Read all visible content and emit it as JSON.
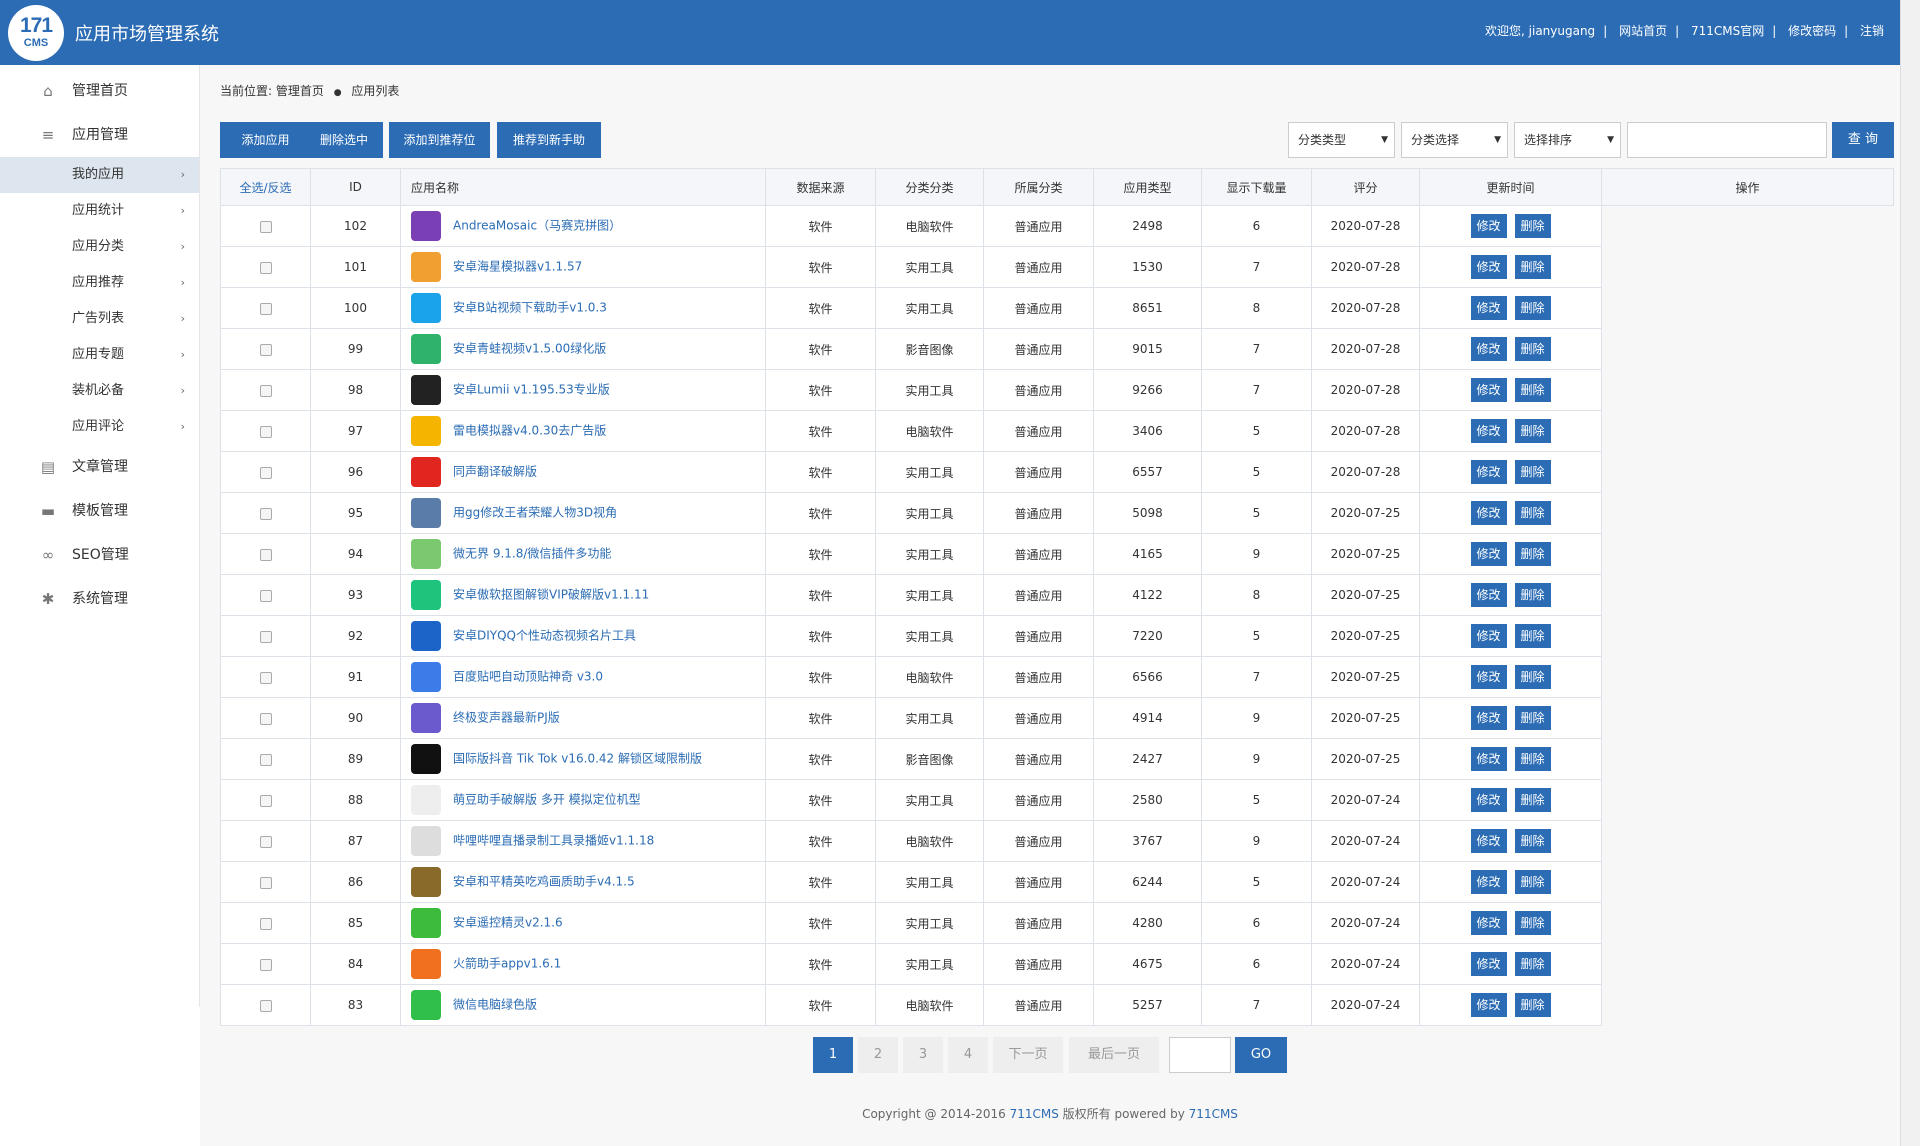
{
  "header": {
    "logo_top": "171",
    "logo_bottom": "CMS",
    "title": "应用市场管理系统",
    "welcome": "欢迎您, jianyugang",
    "links": [
      "网站首页",
      "711CMS官网",
      "修改密码",
      "注销"
    ]
  },
  "sidebar": {
    "home": "管理首页",
    "app_mgmt": "应用管理",
    "app_items": [
      "我的应用",
      "应用统计",
      "应用分类",
      "应用推荐",
      "广告列表",
      "应用专题",
      "装机必备",
      "应用评论"
    ],
    "article_mgmt": "文章管理",
    "template_mgmt": "模板管理",
    "seo_mgmt": "SEO管理",
    "system_mgmt": "系统管理"
  },
  "breadcrumb": {
    "prefix": "当前位置:",
    "home": "管理首页",
    "current": "应用列表"
  },
  "toolbar": {
    "add": "添加应用",
    "delete_selected": "删除选中",
    "add_recommend": "添加到推荐位",
    "recommend_mobile": "推荐到新手助",
    "filter_type": "分类类型",
    "filter_select": "分类选择",
    "sort_select": "选择排序",
    "search_button": "查 询"
  },
  "table": {
    "headers": [
      "全选/反选",
      "ID",
      "应用名称",
      "数据来源",
      "分类分类",
      "所属分类",
      "应用类型",
      "显示下载量",
      "评分",
      "更新时间",
      "操作"
    ],
    "edit_label": "修改",
    "delete_label": "删除",
    "rows": [
      {
        "id": "102",
        "name": "AndreaMosaic（马赛克拼图）",
        "source": "软件",
        "cat": "电脑软件",
        "belong": "普通应用",
        "type": "2498",
        "downloads": "6",
        "date": "2020-07-28",
        "icon": "#7b3fb5"
      },
      {
        "id": "101",
        "name": "安卓海星模拟器v1.1.57",
        "source": "软件",
        "cat": "实用工具",
        "belong": "普通应用",
        "type": "1530",
        "downloads": "7",
        "date": "2020-07-28",
        "icon": "#f0a030"
      },
      {
        "id": "100",
        "name": "安卓B站视频下载助手v1.0.3",
        "source": "软件",
        "cat": "实用工具",
        "belong": "普通应用",
        "type": "8651",
        "downloads": "8",
        "date": "2020-07-28",
        "icon": "#1aa3e8"
      },
      {
        "id": "99",
        "name": "安卓青蛙视频v1.5.00绿化版",
        "source": "软件",
        "cat": "影音图像",
        "belong": "普通应用",
        "type": "9015",
        "downloads": "7",
        "date": "2020-07-28",
        "icon": "#2fb36a"
      },
      {
        "id": "98",
        "name": "安卓Lumii v1.195.53专业版",
        "source": "软件",
        "cat": "实用工具",
        "belong": "普通应用",
        "type": "9266",
        "downloads": "7",
        "date": "2020-07-28",
        "icon": "#222222"
      },
      {
        "id": "97",
        "name": "雷电模拟器v4.0.30去广告版",
        "source": "软件",
        "cat": "电脑软件",
        "belong": "普通应用",
        "type": "3406",
        "downloads": "5",
        "date": "2020-07-28",
        "icon": "#f5b400"
      },
      {
        "id": "96",
        "name": "同声翻译破解版",
        "source": "软件",
        "cat": "实用工具",
        "belong": "普通应用",
        "type": "6557",
        "downloads": "5",
        "date": "2020-07-28",
        "icon": "#e0261e"
      },
      {
        "id": "95",
        "name": "用gg修改王者荣耀人物3D视角",
        "source": "软件",
        "cat": "实用工具",
        "belong": "普通应用",
        "type": "5098",
        "downloads": "5",
        "date": "2020-07-25",
        "icon": "#5a7ca8"
      },
      {
        "id": "94",
        "name": "微无界 9.1.8/微信插件多功能",
        "source": "软件",
        "cat": "实用工具",
        "belong": "普通应用",
        "type": "4165",
        "downloads": "9",
        "date": "2020-07-25",
        "icon": "#7bc96f"
      },
      {
        "id": "93",
        "name": "安卓傲软抠图解锁VIP破解版v1.1.11",
        "source": "软件",
        "cat": "实用工具",
        "belong": "普通应用",
        "type": "4122",
        "downloads": "8",
        "date": "2020-07-25",
        "icon": "#1ec47c"
      },
      {
        "id": "92",
        "name": "安卓DIYQQ个性动态视频名片工具",
        "source": "软件",
        "cat": "实用工具",
        "belong": "普通应用",
        "type": "7220",
        "downloads": "5",
        "date": "2020-07-25",
        "icon": "#1c64c8"
      },
      {
        "id": "91",
        "name": "百度贴吧自动顶贴神奇 v3.0",
        "source": "软件",
        "cat": "电脑软件",
        "belong": "普通应用",
        "type": "6566",
        "downloads": "7",
        "date": "2020-07-25",
        "icon": "#3b7ce8"
      },
      {
        "id": "90",
        "name": "终极变声器最新PJ版",
        "source": "软件",
        "cat": "实用工具",
        "belong": "普通应用",
        "type": "4914",
        "downloads": "9",
        "date": "2020-07-25",
        "icon": "#6a5acd"
      },
      {
        "id": "89",
        "name": "国际版抖音 Tik Tok v16.0.42 解锁区域限制版",
        "source": "软件",
        "cat": "影音图像",
        "belong": "普通应用",
        "type": "2427",
        "downloads": "9",
        "date": "2020-07-25",
        "icon": "#111111"
      },
      {
        "id": "88",
        "name": "萌豆助手破解版 多开 模拟定位机型",
        "source": "软件",
        "cat": "实用工具",
        "belong": "普通应用",
        "type": "2580",
        "downloads": "5",
        "date": "2020-07-24",
        "icon": "#eeeeee"
      },
      {
        "id": "87",
        "name": "哔哩哔哩直播录制工具录播姬v1.1.18",
        "source": "软件",
        "cat": "电脑软件",
        "belong": "普通应用",
        "type": "3767",
        "downloads": "9",
        "date": "2020-07-24",
        "icon": "#dddddd"
      },
      {
        "id": "86",
        "name": "安卓和平精英吃鸡画质助手v4.1.5",
        "source": "软件",
        "cat": "实用工具",
        "belong": "普通应用",
        "type": "6244",
        "downloads": "5",
        "date": "2020-07-24",
        "icon": "#8a6a2a"
      },
      {
        "id": "85",
        "name": "安卓遥控精灵v2.1.6",
        "source": "软件",
        "cat": "实用工具",
        "belong": "普通应用",
        "type": "4280",
        "downloads": "6",
        "date": "2020-07-24",
        "icon": "#3cbb3c"
      },
      {
        "id": "84",
        "name": "火箭助手appv1.6.1",
        "source": "软件",
        "cat": "实用工具",
        "belong": "普通应用",
        "type": "4675",
        "downloads": "6",
        "date": "2020-07-24",
        "icon": "#f07020"
      },
      {
        "id": "83",
        "name": "微信电脑绿色版",
        "source": "软件",
        "cat": "电脑软件",
        "belong": "普通应用",
        "type": "5257",
        "downloads": "7",
        "date": "2020-07-24",
        "icon": "#2fbf4a"
      }
    ]
  },
  "pagination": {
    "pages": [
      "1",
      "2",
      "3",
      "4"
    ],
    "next": "下一页",
    "last": "最后一页",
    "go": "GO"
  },
  "footer": {
    "prefix": "Copyright @ 2014-2016",
    "brand1": "711CMS",
    "middle": "版权所有 powered by",
    "brand2": "711CMS"
  }
}
